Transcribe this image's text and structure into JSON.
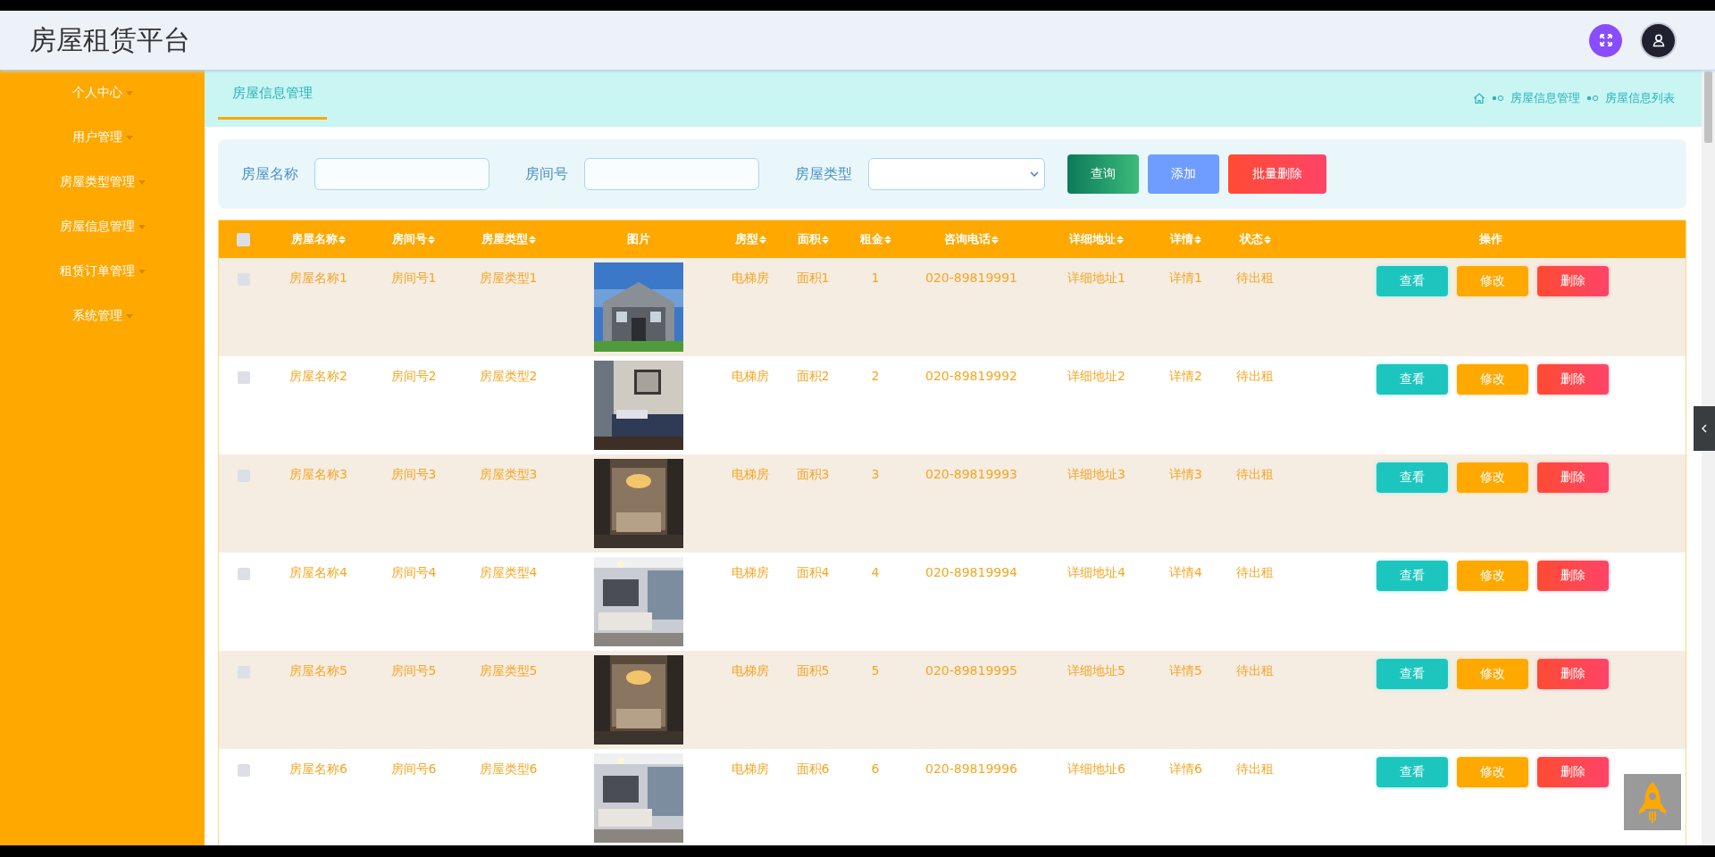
{
  "header": {
    "title": "房屋租赁平台"
  },
  "sidebar": {
    "items": [
      {
        "label": "个人中心",
        "expanded": false
      },
      {
        "label": "用户管理",
        "expanded": false
      },
      {
        "label": "房屋类型管理",
        "expanded": false
      },
      {
        "label": "房屋信息管理",
        "expanded": false
      },
      {
        "label": "租赁订单管理",
        "expanded": false
      },
      {
        "label": "系统管理",
        "expanded": false
      }
    ]
  },
  "tabs": [
    {
      "label": "房屋信息管理",
      "selected": true
    }
  ],
  "breadcrumb": [
    "房屋信息管理",
    "房屋信息列表"
  ],
  "search": {
    "fields": [
      {
        "label": "房屋名称",
        "kind": "text"
      },
      {
        "label": "房间号",
        "kind": "text"
      },
      {
        "label": "房屋类型",
        "kind": "select"
      }
    ],
    "buttons": [
      {
        "label": "查询",
        "kind": "query"
      },
      {
        "label": "添加",
        "kind": "add"
      },
      {
        "label": "批量删除",
        "kind": "delete"
      }
    ]
  },
  "table": {
    "select_all": {
      "checked": false
    },
    "columns": [
      {
        "label": "房屋名称",
        "sortable": true
      },
      {
        "label": "房间号",
        "sortable": true
      },
      {
        "label": "房屋类型",
        "sortable": true
      },
      {
        "label": "图片",
        "sortable": false
      },
      {
        "label": "房型",
        "sortable": true
      },
      {
        "label": "面积",
        "sortable": true
      },
      {
        "label": "租金",
        "sortable": true
      },
      {
        "label": "咨询电话",
        "sortable": true
      },
      {
        "label": "详细地址",
        "sortable": true
      },
      {
        "label": "详情",
        "sortable": true
      },
      {
        "label": "状态",
        "sortable": true
      },
      {
        "label": "操作",
        "sortable": false
      }
    ],
    "rows": [
      {
        "checked": false,
        "cells": [
          "房屋名称1",
          "房间号1",
          "房屋类型1",
          {
            "kind": "picture"
          },
          "电梯房",
          "面积1",
          "1",
          "020-89819991",
          "详细地址1",
          "详情1",
          "待出租"
        ],
        "actions": [
          {
            "label": "查看",
            "kind": "view"
          },
          {
            "label": "修改",
            "kind": "edit"
          },
          {
            "label": "删除",
            "kind": "delete"
          }
        ]
      },
      {
        "checked": false,
        "cells": [
          "房屋名称2",
          "房间号2",
          "房屋类型2",
          {
            "kind": "picture"
          },
          "电梯房",
          "面积2",
          "2",
          "020-89819992",
          "详细地址2",
          "详情2",
          "待出租"
        ],
        "actions": [
          {
            "label": "查看",
            "kind": "view"
          },
          {
            "label": "修改",
            "kind": "edit"
          },
          {
            "label": "删除",
            "kind": "delete"
          }
        ]
      },
      {
        "checked": false,
        "cells": [
          "房屋名称3",
          "房间号3",
          "房屋类型3",
          {
            "kind": "picture"
          },
          "电梯房",
          "面积3",
          "3",
          "020-89819993",
          "详细地址3",
          "详情3",
          "待出租"
        ],
        "actions": [
          {
            "label": "查看",
            "kind": "view"
          },
          {
            "label": "修改",
            "kind": "edit"
          },
          {
            "label": "删除",
            "kind": "delete"
          }
        ]
      },
      {
        "checked": false,
        "cells": [
          "房屋名称4",
          "房间号4",
          "房屋类型4",
          {
            "kind": "picture"
          },
          "电梯房",
          "面积4",
          "4",
          "020-89819994",
          "详细地址4",
          "详情4",
          "待出租"
        ],
        "actions": [
          {
            "label": "查看",
            "kind": "view"
          },
          {
            "label": "修改",
            "kind": "edit"
          },
          {
            "label": "删除",
            "kind": "delete"
          }
        ]
      },
      {
        "checked": false,
        "cells": [
          "房屋名称5",
          "房间号5",
          "房屋类型5",
          {
            "kind": "picture"
          },
          "电梯房",
          "面积5",
          "5",
          "020-89819995",
          "详细地址5",
          "详情5",
          "待出租"
        ],
        "actions": [
          {
            "label": "查看",
            "kind": "view"
          },
          {
            "label": "修改",
            "kind": "edit"
          },
          {
            "label": "删除",
            "kind": "delete"
          }
        ]
      },
      {
        "checked": false,
        "cells": [
          "房屋名称6",
          "房间号6",
          "房屋类型6",
          {
            "kind": "picture"
          },
          "电梯房",
          "面积6",
          "6",
          "020-89819996",
          "详细地址6",
          "详情6",
          "待出租"
        ],
        "actions": [
          {
            "label": "查看",
            "kind": "view"
          },
          {
            "label": "修改",
            "kind": "edit"
          },
          {
            "label": "删除",
            "kind": "delete"
          }
        ]
      }
    ]
  }
}
